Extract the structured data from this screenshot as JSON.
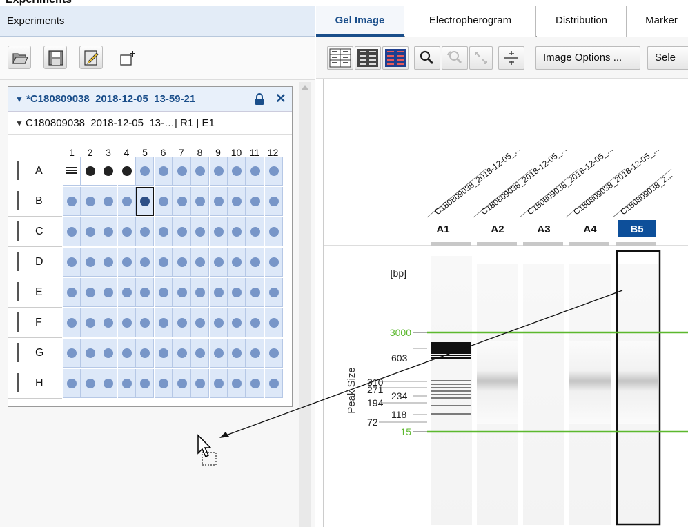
{
  "top_title": "Experiments",
  "left_panel": {
    "header": "Experiments",
    "toolbar": [
      "open-folder-icon",
      "save-icon",
      "edit-icon",
      "new-item-icon"
    ],
    "experiment": {
      "title": "*C180809038_2018-12-05_13-59-21",
      "run": "C180809038_2018-12-05_13-…| R1 | E1",
      "columns": [
        "1",
        "2",
        "3",
        "4",
        "5",
        "6",
        "7",
        "8",
        "9",
        "10",
        "11",
        "12"
      ],
      "rows": [
        "A",
        "B",
        "C",
        "D",
        "E",
        "F",
        "G",
        "H"
      ],
      "selected_well": "B5"
    }
  },
  "right_panel": {
    "tabs": [
      "Gel Image",
      "Electropherogram",
      "Distribution",
      "Marker"
    ],
    "active_tab": "Gel Image",
    "toolbar_buttons": [
      "Image Options ...",
      "Sele"
    ],
    "gel": {
      "lanes": [
        {
          "id": "A1",
          "name": "C180809038_2018-12-05_..."
        },
        {
          "id": "A2",
          "name": "C180809038_2018-12-05_..."
        },
        {
          "id": "A3",
          "name": "C180809038_2018-12-05_..."
        },
        {
          "id": "A4",
          "name": "C180809038_2018-12-05_..."
        },
        {
          "id": "B5",
          "name": "C180809038_2..."
        }
      ],
      "selected_lane": "B5",
      "unit_label": "[bp]",
      "axis_label": "Peak Size",
      "marker_sizes": [
        "3000",
        "15"
      ],
      "ladder_sizes": [
        "603",
        "310",
        "271",
        "234",
        "194",
        "118",
        "72"
      ],
      "marker_color": "#5cb82e"
    }
  }
}
